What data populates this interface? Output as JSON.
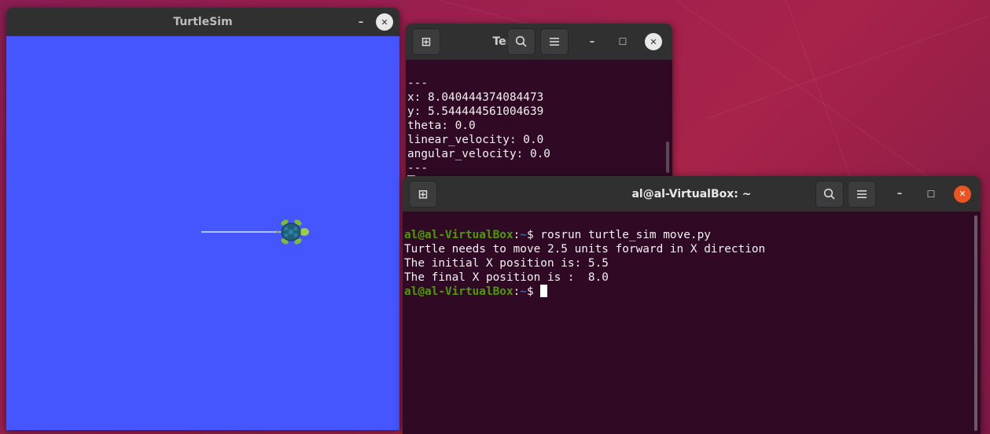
{
  "turtlesim": {
    "title": "TurtleSim",
    "minimize": "–",
    "close": "✕",
    "canvas_color": "#4556ff",
    "pen_color": "#b3b8ff"
  },
  "terminal_small": {
    "title": "Ter...",
    "minimize": "–",
    "maximize": "☐",
    "close": "✕",
    "lines": [
      "---",
      "x: 8.040444374084473",
      "y: 5.544444561004639",
      "theta: 0.0",
      "linear_velocity: 0.0",
      "angular_velocity: 0.0",
      "---"
    ]
  },
  "terminal_main": {
    "title": "al@al-VirtualBox: ~",
    "minimize": "–",
    "maximize": "☐",
    "close": "✕",
    "prompt_user": "al@al-VirtualBox",
    "prompt_sep": ":",
    "prompt_path": "~",
    "prompt_symbol": "$",
    "command": " rosrun turtle_sim move.py",
    "output": [
      "Turtle needs to move 2.5 units forward in X direction",
      "The initial X position is: 5.5",
      "The final X position is :  8.0"
    ]
  },
  "colors": {
    "terminal_bg": "#300a24",
    "titlebar_bg": "#303030",
    "prompt_green": "#4e9a06",
    "prompt_blue": "#3465a4",
    "close_red": "#e95420"
  }
}
